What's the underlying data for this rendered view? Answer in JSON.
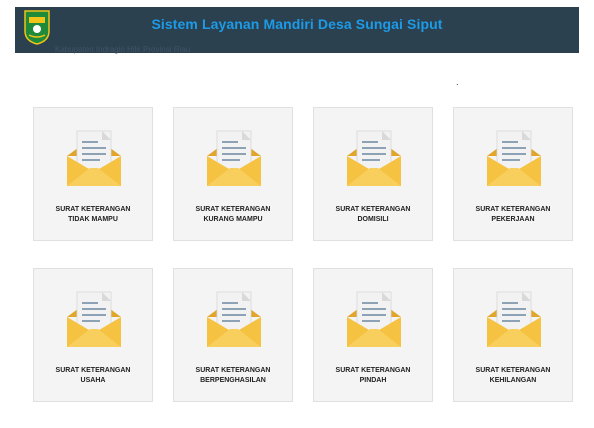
{
  "header": {
    "title": "Sistem Layanan Mandiri Desa Sungai Siput",
    "subtitle": "Kabupaten Indragiri Hilir Provinsi Riau",
    "logo_icon": "regency-emblem-icon"
  },
  "misc": {
    "dot": "."
  },
  "services": [
    {
      "line1": "SURAT KETERANGAN",
      "line2": "TIDAK MAMPU",
      "icon": "envelope-letter-icon"
    },
    {
      "line1": "SURAT KETERANGAN",
      "line2": "KURANG MAMPU",
      "icon": "envelope-letter-icon"
    },
    {
      "line1": "SURAT KETERANGAN",
      "line2": "DOMISILI",
      "icon": "envelope-letter-icon"
    },
    {
      "line1": "SURAT KETERANGAN",
      "line2": "PEKERJAAN",
      "icon": "envelope-letter-icon"
    },
    {
      "line1": "SURAT KETERANGAN",
      "line2": "USAHA",
      "icon": "envelope-letter-icon"
    },
    {
      "line1": "SURAT KETERANGAN",
      "line2": "BERPENGHASILAN",
      "icon": "envelope-letter-icon"
    },
    {
      "line1": "SURAT KETERANGAN",
      "line2": "PINDAH",
      "icon": "envelope-letter-icon"
    },
    {
      "line1": "SURAT KETERANGAN",
      "line2": "KEHILANGAN",
      "icon": "envelope-letter-icon"
    }
  ],
  "colors": {
    "header_bg": "#2c4150",
    "title": "#1b9be8",
    "envelope": "#f5c242",
    "envelope_dark": "#e0a52a",
    "paper": "#f2f2f2",
    "paper_lines": "#8da2b5"
  }
}
